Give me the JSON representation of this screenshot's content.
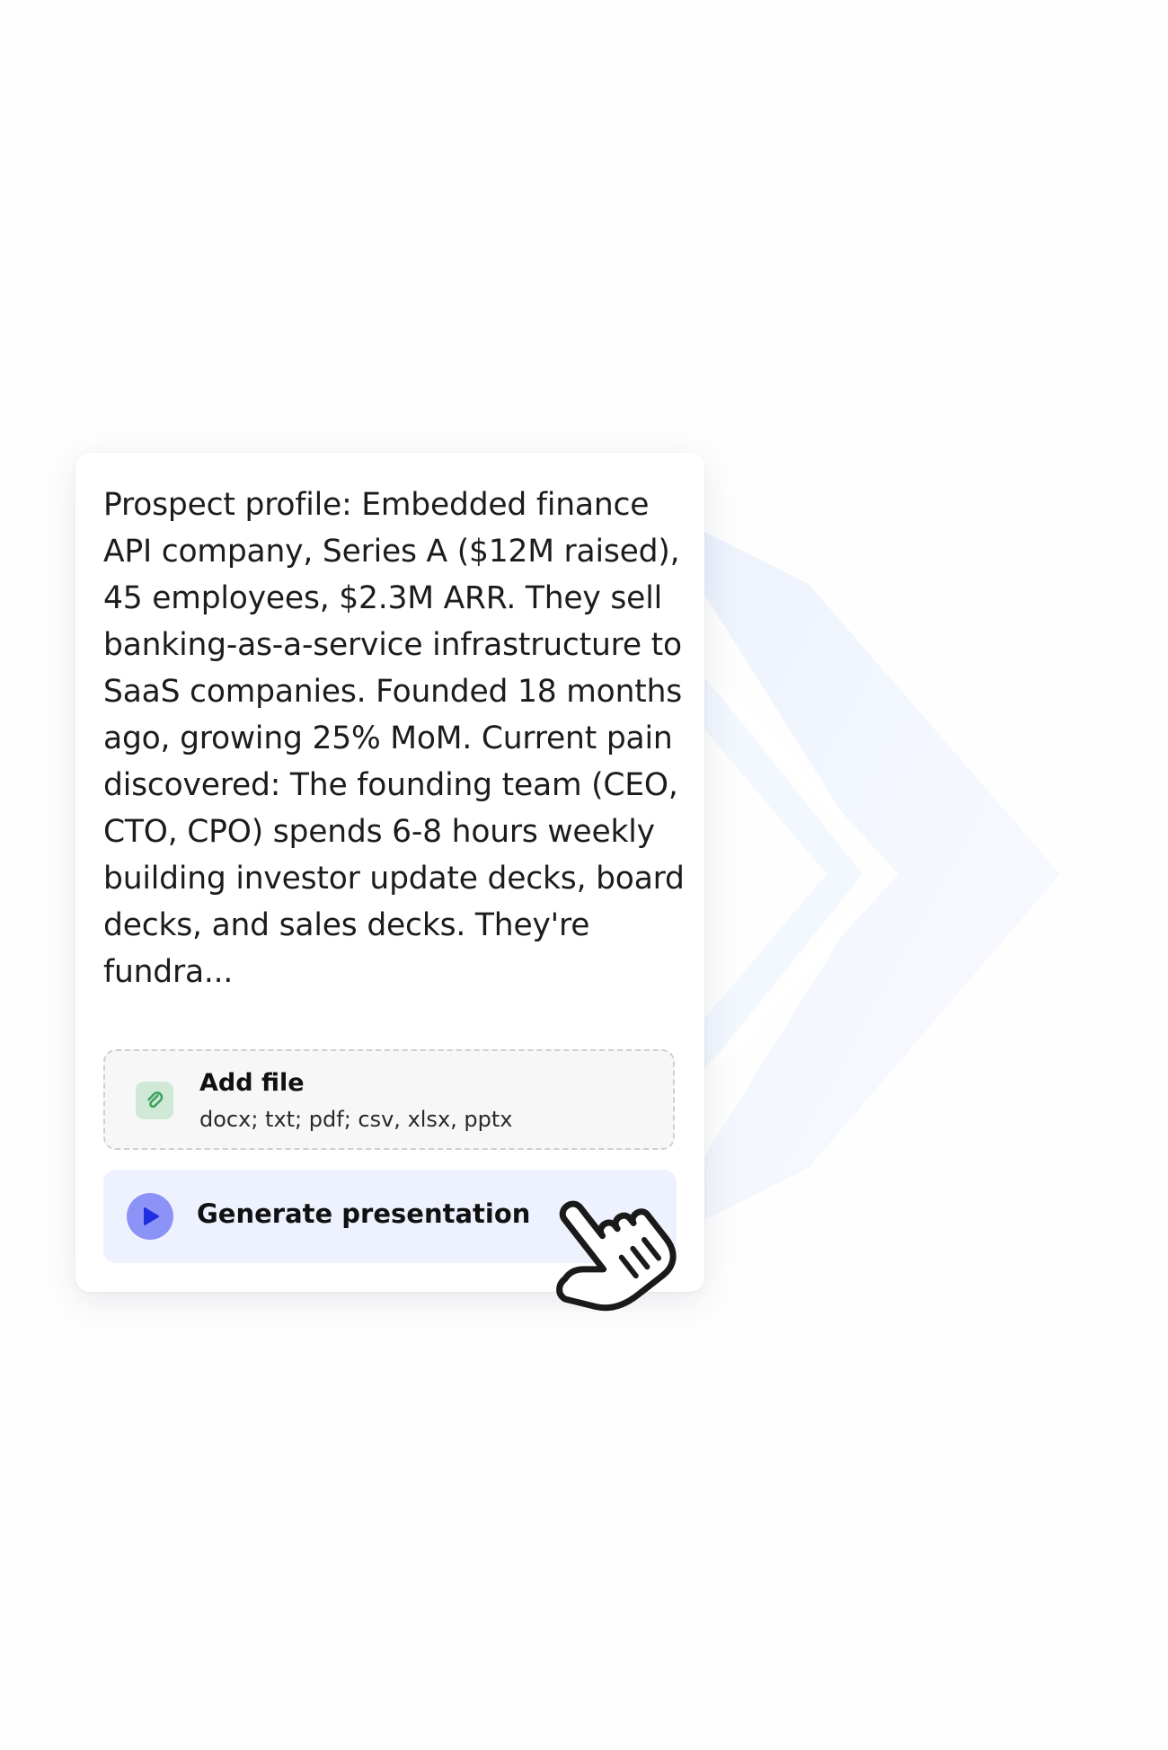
{
  "prompt": {
    "text": "Prospect profile: Embedded finance API company, Series A ($12M raised), 45 employees, $2.3M ARR. They sell banking-as-a-service infrastructure to SaaS companies. Founded 18 months ago, growing 25% MoM. Current pain discovered: The founding team (CEO, CTO, CPO) spends 6-8 hours weekly building investor update decks, board decks, and sales decks. They're fundra..."
  },
  "add_file": {
    "title": "Add file",
    "formats": "docx; txt; pdf; csv, xlsx, pptx",
    "icon": "paperclip-icon"
  },
  "generate": {
    "label": "Generate presentation",
    "icon": "play-icon"
  },
  "cursor": {
    "icon": "hand-pointer-icon"
  },
  "colors": {
    "accent": "#8c93f7",
    "accent_dark": "#1f2fe0",
    "button_bg": "#eef2fe",
    "file_icon_bg": "#cfe9d6",
    "file_icon_fg": "#3aa35c",
    "decor_arrow": "#eef3fd"
  }
}
